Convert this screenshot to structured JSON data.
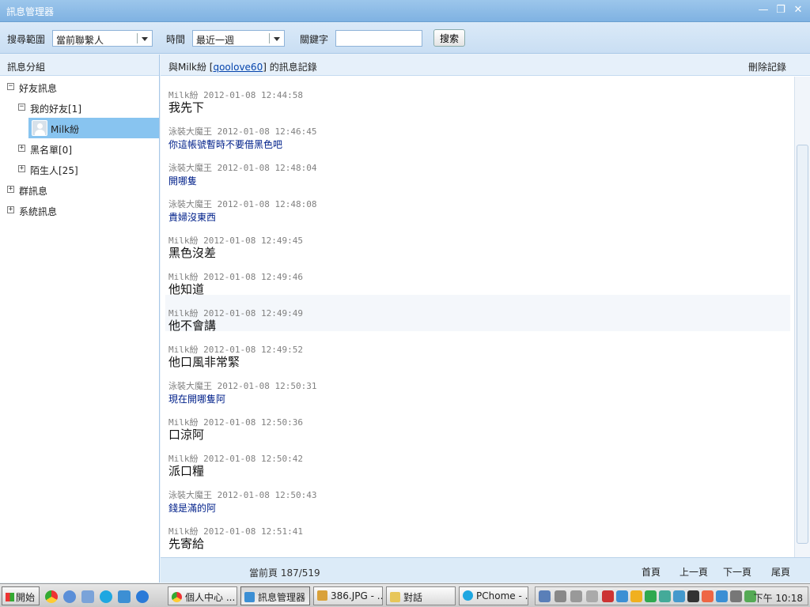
{
  "window": {
    "title": "訊息管理器",
    "minimize": "—",
    "maximize": "❐",
    "close": "✕"
  },
  "search": {
    "scope_label": "搜尋範圍",
    "scope_value": "當前聯繫人",
    "time_label": "時間",
    "time_value": "最近一週",
    "keyword_label": "關鍵字",
    "keyword_value": "",
    "button": "搜索"
  },
  "left": {
    "header": "訊息分組",
    "tree": [
      {
        "label": "好友訊息",
        "toggle": "−"
      },
      {
        "label": "我的好友[1]",
        "toggle": "−"
      },
      {
        "label": "Milk紛"
      },
      {
        "label": "黑名單[0]",
        "toggle": "+"
      },
      {
        "label": "陌生人[25]",
        "toggle": "+"
      },
      {
        "label": "群訊息",
        "toggle": "+"
      },
      {
        "label": "系統訊息",
        "toggle": "+"
      }
    ]
  },
  "conversation": {
    "title_prefix": "與Milk紛 [",
    "contact_id": "qoolove60",
    "title_suffix": "] 的訊息記錄",
    "delete": "刪除記錄"
  },
  "messages": [
    {
      "sender": "Milk紛",
      "time": "2012-01-08 12:44:58",
      "text": "我先下"
    },
    {
      "sender": "泳裝大魔王",
      "time": "2012-01-08 12:46:45",
      "text": "你這帳號暫時不要借黑色吧"
    },
    {
      "sender": "泳裝大魔王",
      "time": "2012-01-08 12:48:04",
      "text": "開哪隻"
    },
    {
      "sender": "泳裝大魔王",
      "time": "2012-01-08 12:48:08",
      "text": "貴婦沒東西"
    },
    {
      "sender": "Milk紛",
      "time": "2012-01-08 12:49:45",
      "text": "黑色沒差"
    },
    {
      "sender": "Milk紛",
      "time": "2012-01-08 12:49:46",
      "text": "他知道"
    },
    {
      "sender": "Milk紛",
      "time": "2012-01-08 12:49:49",
      "text": "他不會講"
    },
    {
      "sender": "Milk紛",
      "time": "2012-01-08 12:49:52",
      "text": "他口風非常緊"
    },
    {
      "sender": "泳裝大魔王",
      "time": "2012-01-08 12:50:31",
      "text": "現在開哪隻阿"
    },
    {
      "sender": "Milk紛",
      "time": "2012-01-08 12:50:36",
      "text": "口涼阿"
    },
    {
      "sender": "Milk紛",
      "time": "2012-01-08 12:50:42",
      "text": "派口糧"
    },
    {
      "sender": "泳裝大魔王",
      "time": "2012-01-08 12:50:43",
      "text": "錢是滿的阿"
    },
    {
      "sender": "Milk紛",
      "time": "2012-01-08 12:51:41",
      "text": "先寄給"
    }
  ],
  "pager": {
    "current": "當前頁 187/519",
    "first": "首頁",
    "prev": "上一頁",
    "next": "下一頁",
    "last": "尾頁"
  },
  "taskbar": {
    "start": "開始",
    "tasks": [
      "個人中心 ...",
      "訊息管理器",
      "386.JPG - ...",
      "對話",
      "PChome - ..."
    ],
    "clock": "下午 10:18"
  }
}
